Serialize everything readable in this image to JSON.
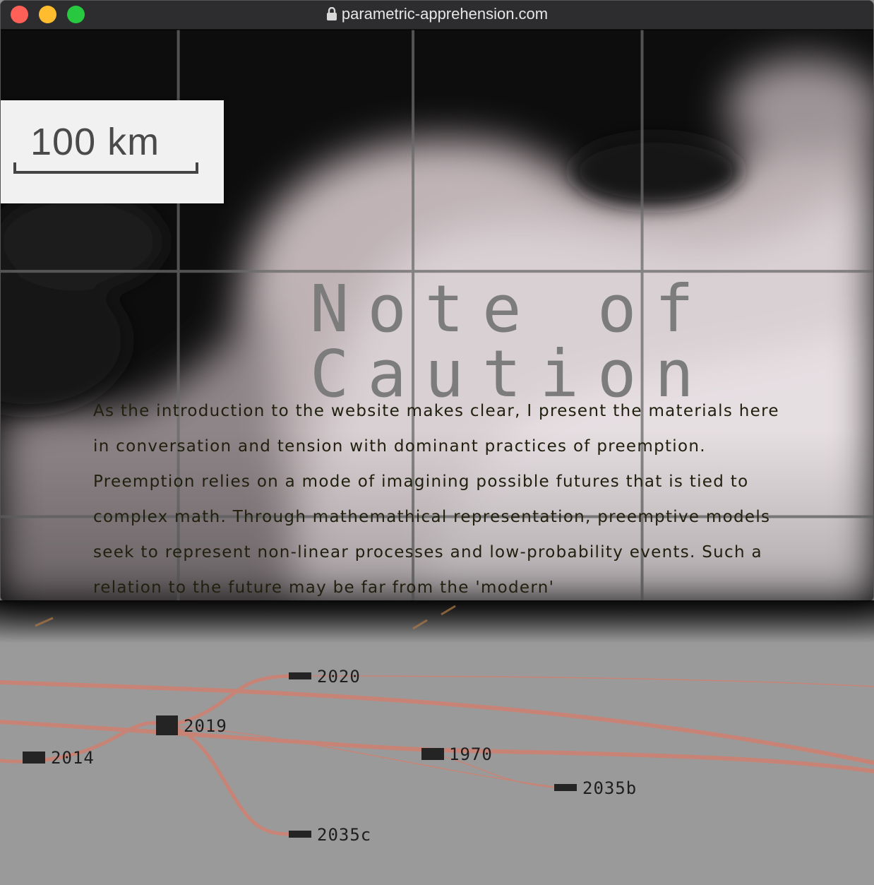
{
  "browser": {
    "url": "parametric-apprehension.com",
    "lock_icon": "lock-icon"
  },
  "map": {
    "scale_label": "100 km"
  },
  "note": {
    "title": "Note of Caution",
    "paragraph": "As the introduction to the website makes clear, I present the materials here in conversation and tension with dominant practices of preemption. Preemption relies on a mode of imagining possible futures that is tied to complex math. Through mathemathical representation, preemptive models seek to represent non-linear processes and low-probability events. Such a relation to the future may be far from the 'modern'"
  },
  "timeline": {
    "line_color": "#d08070",
    "nodes": [
      {
        "id": "2020",
        "label": "2020"
      },
      {
        "id": "2019",
        "label": "2019"
      },
      {
        "id": "2014",
        "label": "2014"
      },
      {
        "id": "1970",
        "label": "1970"
      },
      {
        "id": "2035b",
        "label": "2035b"
      },
      {
        "id": "2035c",
        "label": "2035c"
      }
    ]
  }
}
